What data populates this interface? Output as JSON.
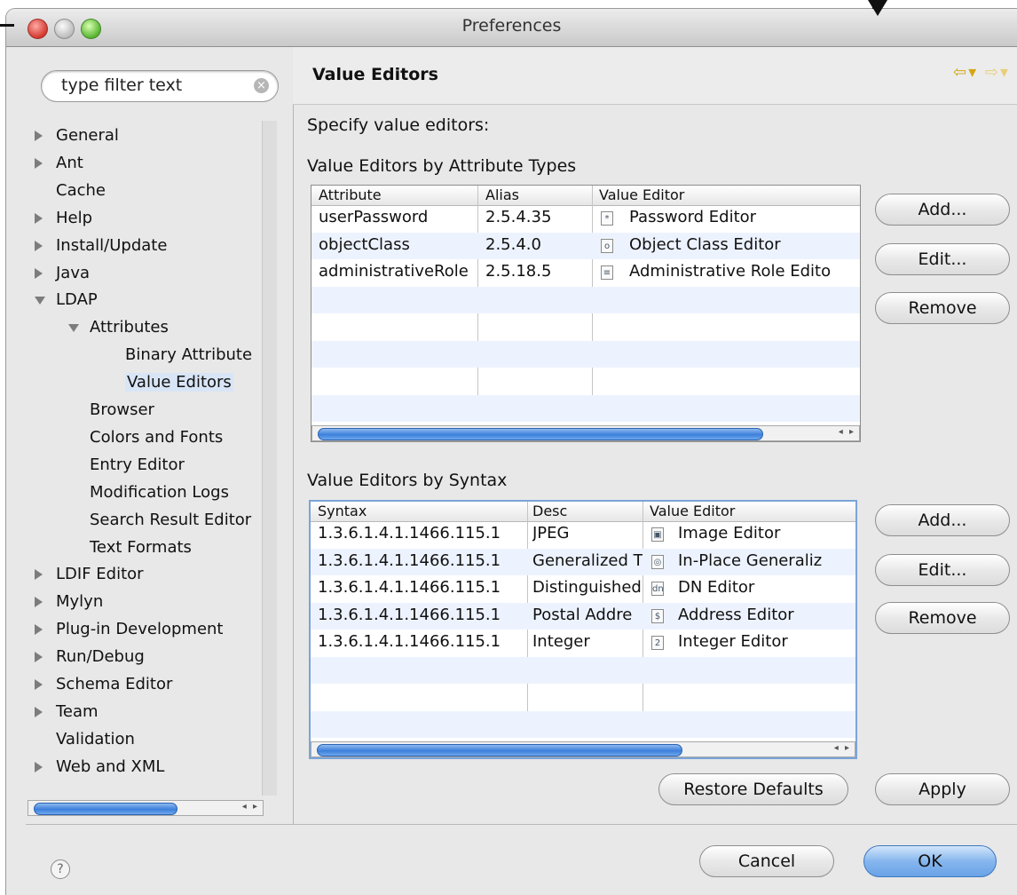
{
  "window": {
    "title": "Preferences"
  },
  "filter": {
    "text": "type filter text"
  },
  "tree": [
    {
      "label": "General",
      "level": 0,
      "arrow": "right"
    },
    {
      "label": "Ant",
      "level": 0,
      "arrow": "right"
    },
    {
      "label": "Cache",
      "level": 0,
      "arrow": ""
    },
    {
      "label": "Help",
      "level": 0,
      "arrow": "right"
    },
    {
      "label": "Install/Update",
      "level": 0,
      "arrow": "right"
    },
    {
      "label": "Java",
      "level": 0,
      "arrow": "right"
    },
    {
      "label": "LDAP",
      "level": 0,
      "arrow": "down"
    },
    {
      "label": "Attributes",
      "level": 1,
      "arrow": "down"
    },
    {
      "label": "Binary Attribute",
      "level": 2,
      "arrow": ""
    },
    {
      "label": "Value Editors",
      "level": 2,
      "arrow": "",
      "selected": true
    },
    {
      "label": "Browser",
      "level": 1,
      "arrow": ""
    },
    {
      "label": "Colors and Fonts",
      "level": 1,
      "arrow": ""
    },
    {
      "label": "Entry Editor",
      "level": 1,
      "arrow": ""
    },
    {
      "label": "Modification Logs",
      "level": 1,
      "arrow": ""
    },
    {
      "label": "Search Result Editor",
      "level": 1,
      "arrow": ""
    },
    {
      "label": "Text Formats",
      "level": 1,
      "arrow": ""
    },
    {
      "label": "LDIF Editor",
      "level": 0,
      "arrow": "right"
    },
    {
      "label": "Mylyn",
      "level": 0,
      "arrow": "right"
    },
    {
      "label": "Plug-in Development",
      "level": 0,
      "arrow": "right"
    },
    {
      "label": "Run/Debug",
      "level": 0,
      "arrow": "right"
    },
    {
      "label": "Schema Editor",
      "level": 0,
      "arrow": "right"
    },
    {
      "label": "Team",
      "level": 0,
      "arrow": "right"
    },
    {
      "label": "Validation",
      "level": 0,
      "arrow": ""
    },
    {
      "label": "Web and XML",
      "level": 0,
      "arrow": "right"
    }
  ],
  "page": {
    "title": "Value Editors",
    "description": "Specify value editors:",
    "attr_section": "Value Editors by Attribute Types",
    "syntax_section": "Value Editors by Syntax"
  },
  "attr_table": {
    "headers": [
      "Attribute",
      "Alias",
      "Value Editor"
    ],
    "rows": [
      {
        "c1": "userPassword",
        "c2": "2.5.4.35",
        "icon": "password-editor-icon",
        "glyph": "*",
        "c3": "Password Editor"
      },
      {
        "c1": "objectClass",
        "c2": "2.5.4.0",
        "icon": "object-class-editor-icon",
        "glyph": "o",
        "c3": "Object Class Editor"
      },
      {
        "c1": "administrativeRole",
        "c2": "2.5.18.5",
        "icon": "document-icon",
        "glyph": "≡",
        "c3": "Administrative Role Edito"
      }
    ]
  },
  "syntax_table": {
    "headers": [
      "Syntax",
      "Desc",
      "Value Editor"
    ],
    "rows": [
      {
        "c1": "1.3.6.1.4.1.1466.115.1",
        "c2": "JPEG",
        "icon": "image-editor-icon",
        "glyph": "▣",
        "c3": "Image Editor"
      },
      {
        "c1": "1.3.6.1.4.1.1466.115.1",
        "c2": "Generalized T",
        "icon": "in-place-editor-icon",
        "glyph": "◎",
        "c3": "In-Place Generaliz"
      },
      {
        "c1": "1.3.6.1.4.1.1466.115.1",
        "c2": "Distinguished",
        "icon": "dn-editor-icon",
        "glyph": "dn",
        "c3": "DN Editor"
      },
      {
        "c1": "1.3.6.1.4.1.1466.115.1",
        "c2": "Postal Addre",
        "icon": "address-editor-icon",
        "glyph": "$",
        "c3": "Address Editor"
      },
      {
        "c1": "1.3.6.1.4.1.1466.115.1",
        "c2": "Integer",
        "icon": "integer-editor-icon",
        "glyph": "2",
        "c3": "Integer Editor"
      }
    ]
  },
  "buttons": {
    "add": "Add...",
    "edit": "Edit...",
    "remove": "Remove",
    "restore_defaults": "Restore Defaults",
    "apply": "Apply",
    "cancel": "Cancel",
    "ok": "OK"
  },
  "icons": {
    "help": "?",
    "search_clear": "×",
    "nav_back": "⇦▾",
    "nav_forward": "⇨▾",
    "scroll_arrows": "◂ ▸"
  }
}
